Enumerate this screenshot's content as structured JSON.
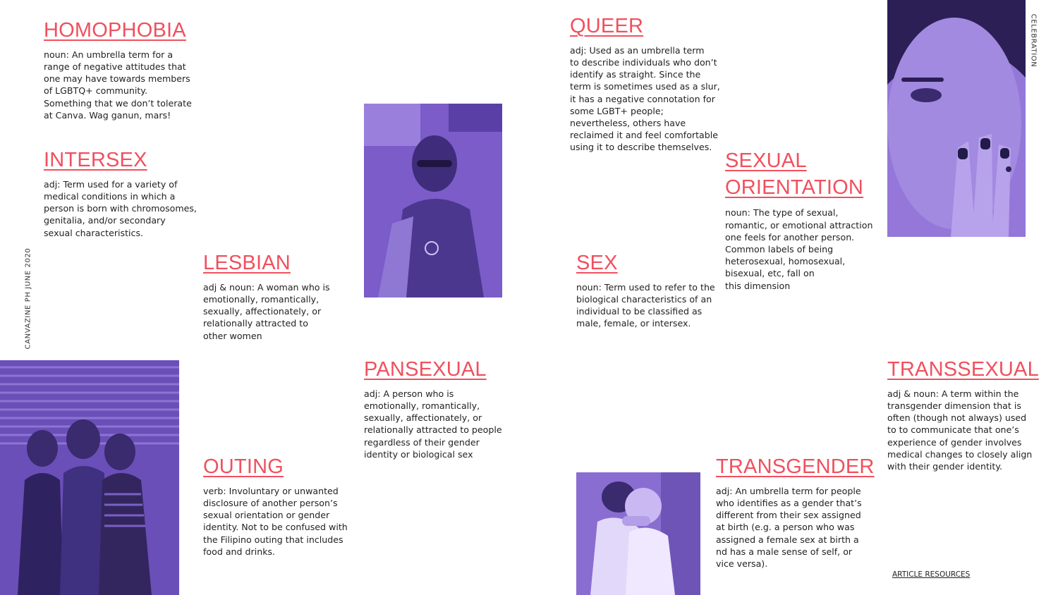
{
  "side_labels": {
    "left": "CANVAZINE PH JUNE 2020",
    "right": "CELEBRATION"
  },
  "footer": {
    "resources_link": "ARTICLE RESOURCES"
  },
  "terms": {
    "homophobia": {
      "title": "HOMOPHOBIA",
      "definition": "noun: An umbrella term for a\nrange of negative attitudes that\none may have towards members\n of LGBTQ+ community.\nSomething that we don’t tolerate\nat Canva. Wag ganun, mars!"
    },
    "intersex": {
      "title": "INTERSEX",
      "definition": "adj: Term used for a variety of\nmedical conditions in which a\nperson is born with chromosomes,\ngenitalia, and/or secondary\nsexual characteristics."
    },
    "lesbian": {
      "title": "LESBIAN",
      "definition": "adj & noun: A woman who is\nemotionally, romantically,\nsexually, affectionately, or\nrelationally attracted to\nother women"
    },
    "outing": {
      "title": "OUTING",
      "definition": "verb: Involuntary or unwanted\ndisclosure of another person’s\nsexual orientation or gender\nidentity. Not to be confused with\nthe Filipino outing that includes\nfood and drinks."
    },
    "pansexual": {
      "title": "PANSEXUAL",
      "definition": "adj:  A person who is\nemotionally, romantically,\nsexually, affectionately, or\nrelationally attracted to people\nregardless of their gender\nidentity or biological sex"
    },
    "queer": {
      "title": "QUEER",
      "definition": "adj: Used as an umbrella term\nto describe individuals who don’t\nidentify as straight. Since the\nterm is sometimes used as a slur,\nit has a negative connotation for\nsome LGBT+ people;\nnevertheless, others have\nreclaimed it and feel comfortable\nusing it to describe themselves."
    },
    "sex": {
      "title": "SEX",
      "definition": "noun: Term used to refer to the\nbiological characteristics of an\nindividual to be classified as\nmale, female, or intersex."
    },
    "sexual_orientation": {
      "title": "SEXUAL ORIENTATION",
      "definition": "noun: The type of sexual,\nromantic, or emotional attraction\none feels for another person.\nCommon labels of being\nheterosexual, homosexual,\nbisexual, etc, fall on\nthis dimension"
    },
    "transgender": {
      "title": "TRANSGENDER",
      "definition": "adj:  An umbrella term for people\nwho identifies as a gender that’s\ndifferent from their sex assigned\nat birth (e.g. a person who was\nassigned a female sex at birth a\nnd has a male sense of self, or\nvice versa)."
    },
    "transsexual": {
      "title": "TRANSSEXUAL",
      "definition": "adj & noun: A term within the\ntransgender dimension that is\noften (though not always) used\nto to communicate that one’s\nexperience of gender involves\nmedical changes to closely align\nwith their gender identity."
    }
  },
  "colors": {
    "heading": "#f0505e",
    "photo_tint": "#7a56c8",
    "photo_dark": "#3a2a6e"
  }
}
